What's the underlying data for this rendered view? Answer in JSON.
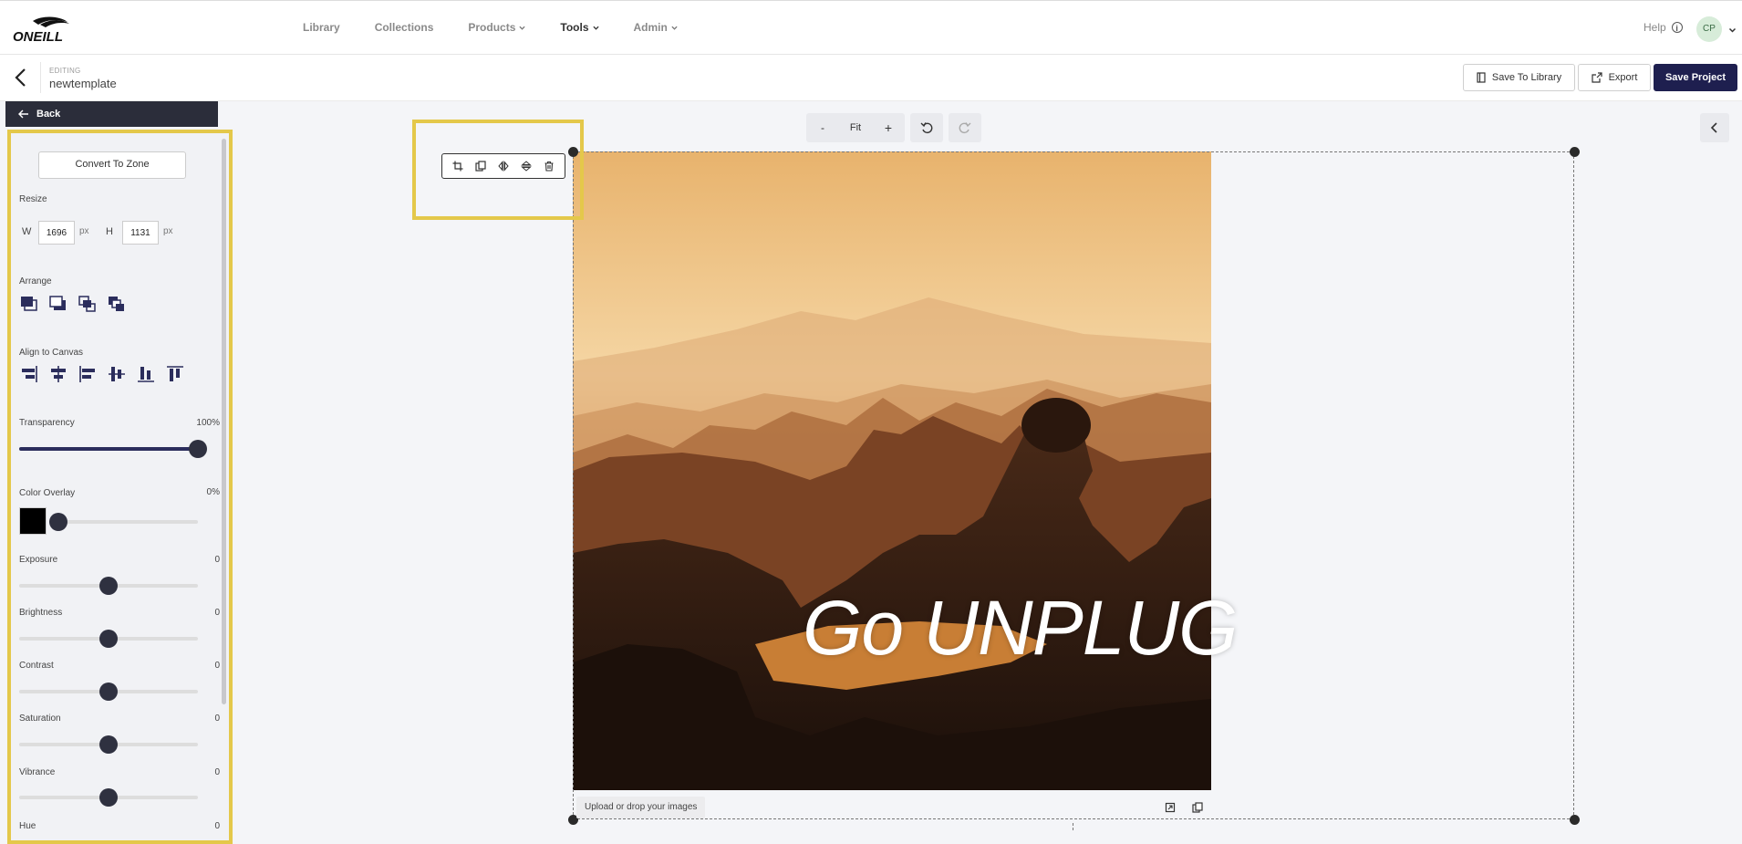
{
  "brand": {
    "logo_text": "ONEILL"
  },
  "nav": {
    "items": [
      {
        "label": "Library",
        "dropdown": false,
        "active": false
      },
      {
        "label": "Collections",
        "dropdown": false,
        "active": false
      },
      {
        "label": "Products",
        "dropdown": true,
        "active": false
      },
      {
        "label": "Tools",
        "dropdown": true,
        "active": true
      },
      {
        "label": "Admin",
        "dropdown": true,
        "active": false
      }
    ],
    "help_label": "Help",
    "avatar_initials": "CP"
  },
  "editbar": {
    "editing_label": "EDITING",
    "template_name": "newtemplate",
    "save_library_label": "Save To Library",
    "export_label": "Export",
    "save_project_label": "Save Project"
  },
  "sidebar": {
    "back_label": "Back",
    "convert_label": "Convert To Zone",
    "resize_label": "Resize",
    "width_letter": "W",
    "width_value": "1696",
    "height_letter": "H",
    "height_value": "1131",
    "unit": "px",
    "arrange_label": "Arrange",
    "align_label": "Align to Canvas",
    "transparency": {
      "label": "Transparency",
      "value_text": "100%",
      "fraction": 1.0
    },
    "color_overlay": {
      "label": "Color Overlay",
      "value_text": "0%",
      "fraction": 0.0,
      "color": "#000000"
    },
    "adjustments": [
      {
        "label": "Exposure",
        "value_text": "0",
        "fraction": 0.5
      },
      {
        "label": "Brightness",
        "value_text": "0",
        "fraction": 0.5
      },
      {
        "label": "Contrast",
        "value_text": "0",
        "fraction": 0.5
      },
      {
        "label": "Saturation",
        "value_text": "0",
        "fraction": 0.5
      },
      {
        "label": "Vibrance",
        "value_text": "0",
        "fraction": 0.5
      }
    ],
    "hue": {
      "label": "Hue",
      "value_text": "0"
    }
  },
  "zoom": {
    "minus_label": "-",
    "fit_label": "Fit",
    "plus_label": "+"
  },
  "canvas": {
    "headline": "Go UNPLUG",
    "upload_label": "Upload or drop your images"
  },
  "colors": {
    "accent": "#1e1f4f",
    "highlight": "#e4c84a"
  }
}
